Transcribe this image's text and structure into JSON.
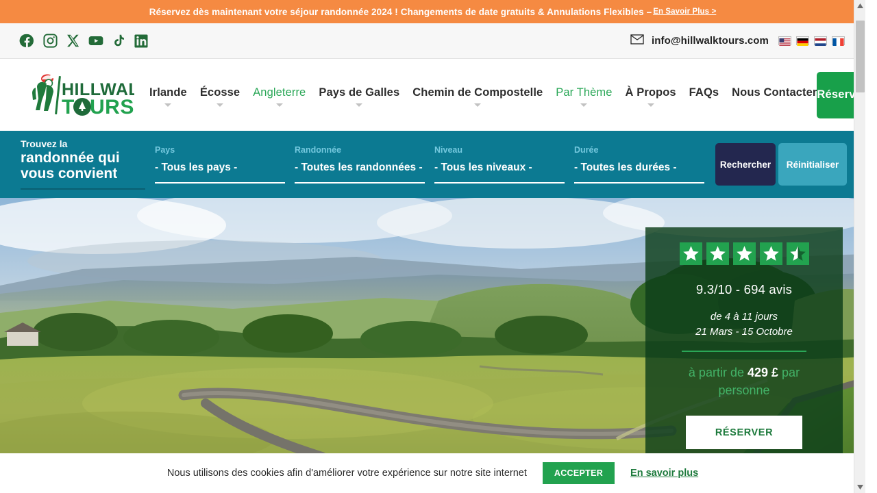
{
  "promo": {
    "text": "Réservez dès maintenant votre séjour randonnée 2024 ! Changements de date gratuits & Annulations Flexibles –",
    "link": "En Savoir Plus >",
    "bg": "#f58a42"
  },
  "topbar": {
    "socials": [
      {
        "name": "facebook-icon",
        "label": "Facebook"
      },
      {
        "name": "instagram-icon",
        "label": "Instagram"
      },
      {
        "name": "x-twitter-icon",
        "label": "X"
      },
      {
        "name": "youtube-icon",
        "label": "YouTube"
      },
      {
        "name": "tiktok-icon",
        "label": "TikTok"
      },
      {
        "name": "linkedin-icon",
        "label": "LinkedIn"
      }
    ],
    "email": "info@hillwalktours.com",
    "flags": [
      {
        "name": "flag-us",
        "label": "English (US)"
      },
      {
        "name": "flag-de",
        "label": "Deutsch"
      },
      {
        "name": "flag-nl",
        "label": "Nederlands"
      },
      {
        "name": "flag-fr",
        "label": "Français"
      }
    ]
  },
  "brand": {
    "line1": "HILLWALK",
    "line2": "TOURS"
  },
  "nav": {
    "items": [
      {
        "label": "Irlande",
        "active": false,
        "caret": true
      },
      {
        "label": "Écosse",
        "active": false,
        "caret": true
      },
      {
        "label": "Angleterre",
        "active": true,
        "caret": true
      },
      {
        "label": "Pays de Galles",
        "active": false,
        "caret": true
      },
      {
        "label": "Chemin de Compostelle",
        "active": false,
        "caret": true
      },
      {
        "label": "Par Thème",
        "active": true,
        "caret": true
      },
      {
        "label": "À Propos",
        "active": false,
        "caret": true
      },
      {
        "label": "FAQs",
        "active": false,
        "caret": false
      },
      {
        "label": "Nous Contacter",
        "active": false,
        "caret": false
      }
    ],
    "cta": "Réserver"
  },
  "finder": {
    "title_line1": "Trouvez la",
    "title_line2": "randonnée qui",
    "title_line3": "vous convient",
    "fields": [
      {
        "label": "Pays",
        "value": "- Tous les pays -"
      },
      {
        "label": "Randonnée",
        "value": "- Toutes les randonnées -"
      },
      {
        "label": "Niveau",
        "value": "- Tous les niveaux -"
      },
      {
        "label": "Durée",
        "value": "- Toutes les durées -"
      }
    ],
    "search_button": "Rechercher",
    "reset_button": "Réinitialiser",
    "bg": "#0c7a92"
  },
  "hero": {
    "card": {
      "stars_total": 5,
      "stars_filled": 4,
      "stars_half": 1,
      "rating": "9.3/10 - 694 avis",
      "duration": "de 4 à 11 jours",
      "season": "21 Mars - 15 Octobre",
      "price_prefix": "à partir de",
      "price": "429 £",
      "price_suffix": "par personne",
      "cta": "RÉSERVER",
      "accent": "#2aa757"
    }
  },
  "cookie": {
    "text": "Nous utilisons des cookies afin d'améliorer votre expérience sur notre site internet",
    "accept": "ACCEPTER",
    "more": "En savoir plus"
  }
}
